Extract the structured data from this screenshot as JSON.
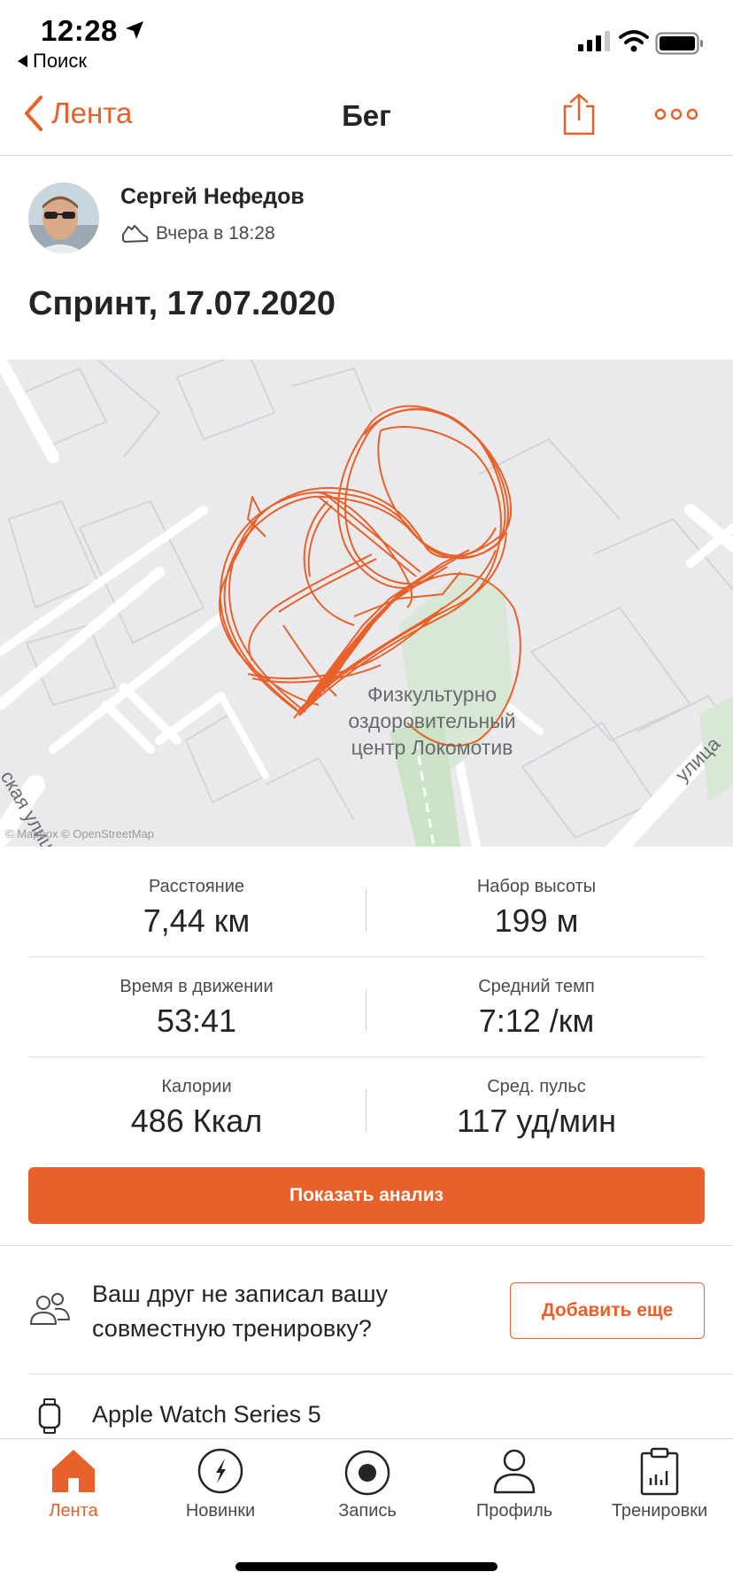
{
  "status_bar": {
    "time": "12:28",
    "back_app_label": "Поиск"
  },
  "nav": {
    "back_label": "Лента",
    "title": "Бег"
  },
  "activity": {
    "athlete_name": "Сергей Нефедов",
    "timestamp": "Вчера в 18:28",
    "title": "Спринт, 17.07.2020"
  },
  "map": {
    "poi_line1": "Физкультурно",
    "poi_line2": "оздоровительный",
    "poi_line3": "центр Локомотив",
    "street_left": "ская улица",
    "street_right": "улица",
    "attribution": "© Mapbox © OpenStreetMap",
    "route_color": "#e8602a"
  },
  "stats": [
    {
      "left_label": "Расстояние",
      "left_value": "7,44 км",
      "right_label": "Набор высоты",
      "right_value": "199 м"
    },
    {
      "left_label": "Время в движении",
      "left_value": "53:41",
      "right_label": "Средний темп",
      "right_value": "7:12 /км"
    },
    {
      "left_label": "Калории",
      "left_value": "486 Ккал",
      "right_label": "Сред. пульс",
      "right_value": "117 уд/мин"
    }
  ],
  "buttons": {
    "analysis": "Показать анализ",
    "add_more": "Добавить еще"
  },
  "friend_prompt": "Ваш друг не записал вашу совместную тренировку?",
  "device": "Apple Watch Series 5",
  "tabs": [
    {
      "label": "Лента",
      "icon": "home-icon",
      "active": true
    },
    {
      "label": "Новинки",
      "icon": "compass-icon",
      "active": false
    },
    {
      "label": "Запись",
      "icon": "record-icon",
      "active": false
    },
    {
      "label": "Профиль",
      "icon": "profile-icon",
      "active": false
    },
    {
      "label": "Тренировки",
      "icon": "clipboard-chart-icon",
      "active": false
    }
  ],
  "colors": {
    "accent": "#e8602a",
    "text": "#242428",
    "map_background": "#eaeaec",
    "park_green": "#d9e8d6"
  }
}
